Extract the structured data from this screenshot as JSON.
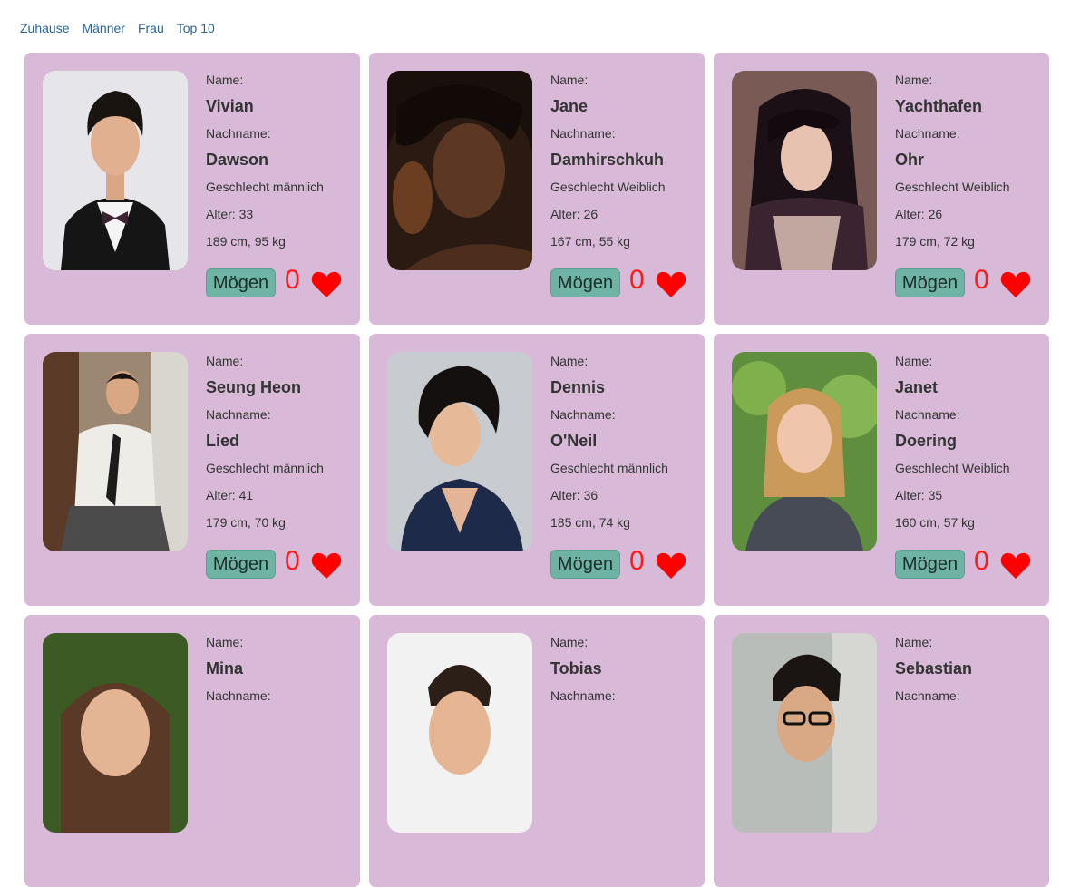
{
  "nav": {
    "home": "Zuhause",
    "men": "Männer",
    "women": "Frau",
    "top10": "Top 10"
  },
  "labels": {
    "name": "Name:",
    "surname": "Nachname:",
    "like_button": "Mögen"
  },
  "colors": {
    "card_bg": "#d8bad8",
    "button_bg": "#6fb3a5",
    "heart": "#ff0000",
    "link": "#2a6496"
  },
  "profiles": [
    {
      "first": "Vivian",
      "last": "Dawson",
      "gender": "Geschlecht männlich",
      "age": "Alter: 33",
      "size": "189 cm, 95 kg",
      "likes": "0"
    },
    {
      "first": "Jane",
      "last": "Damhirschkuh",
      "gender": "Geschlecht Weiblich",
      "age": "Alter: 26",
      "size": "167 cm, 55 kg",
      "likes": "0"
    },
    {
      "first": "Yachthafen",
      "last": "Ohr",
      "gender": "Geschlecht Weiblich",
      "age": "Alter: 26",
      "size": "179 cm, 72 kg",
      "likes": "0"
    },
    {
      "first": "Seung Heon",
      "last": "Lied",
      "gender": "Geschlecht männlich",
      "age": "Alter: 41",
      "size": "179 cm, 70 kg",
      "likes": "0"
    },
    {
      "first": "Dennis",
      "last": "O'Neil",
      "gender": "Geschlecht männlich",
      "age": "Alter: 36",
      "size": "185 cm, 74 kg",
      "likes": "0"
    },
    {
      "first": "Janet",
      "last": "Doering",
      "gender": "Geschlecht Weiblich",
      "age": "Alter: 35",
      "size": "160 cm, 57 kg",
      "likes": "0"
    },
    {
      "first": "Mina",
      "last": "",
      "gender": "",
      "age": "",
      "size": "",
      "likes": ""
    },
    {
      "first": "Tobias",
      "last": "",
      "gender": "",
      "age": "",
      "size": "",
      "likes": ""
    },
    {
      "first": "Sebastian",
      "last": "",
      "gender": "",
      "age": "",
      "size": "",
      "likes": ""
    }
  ]
}
